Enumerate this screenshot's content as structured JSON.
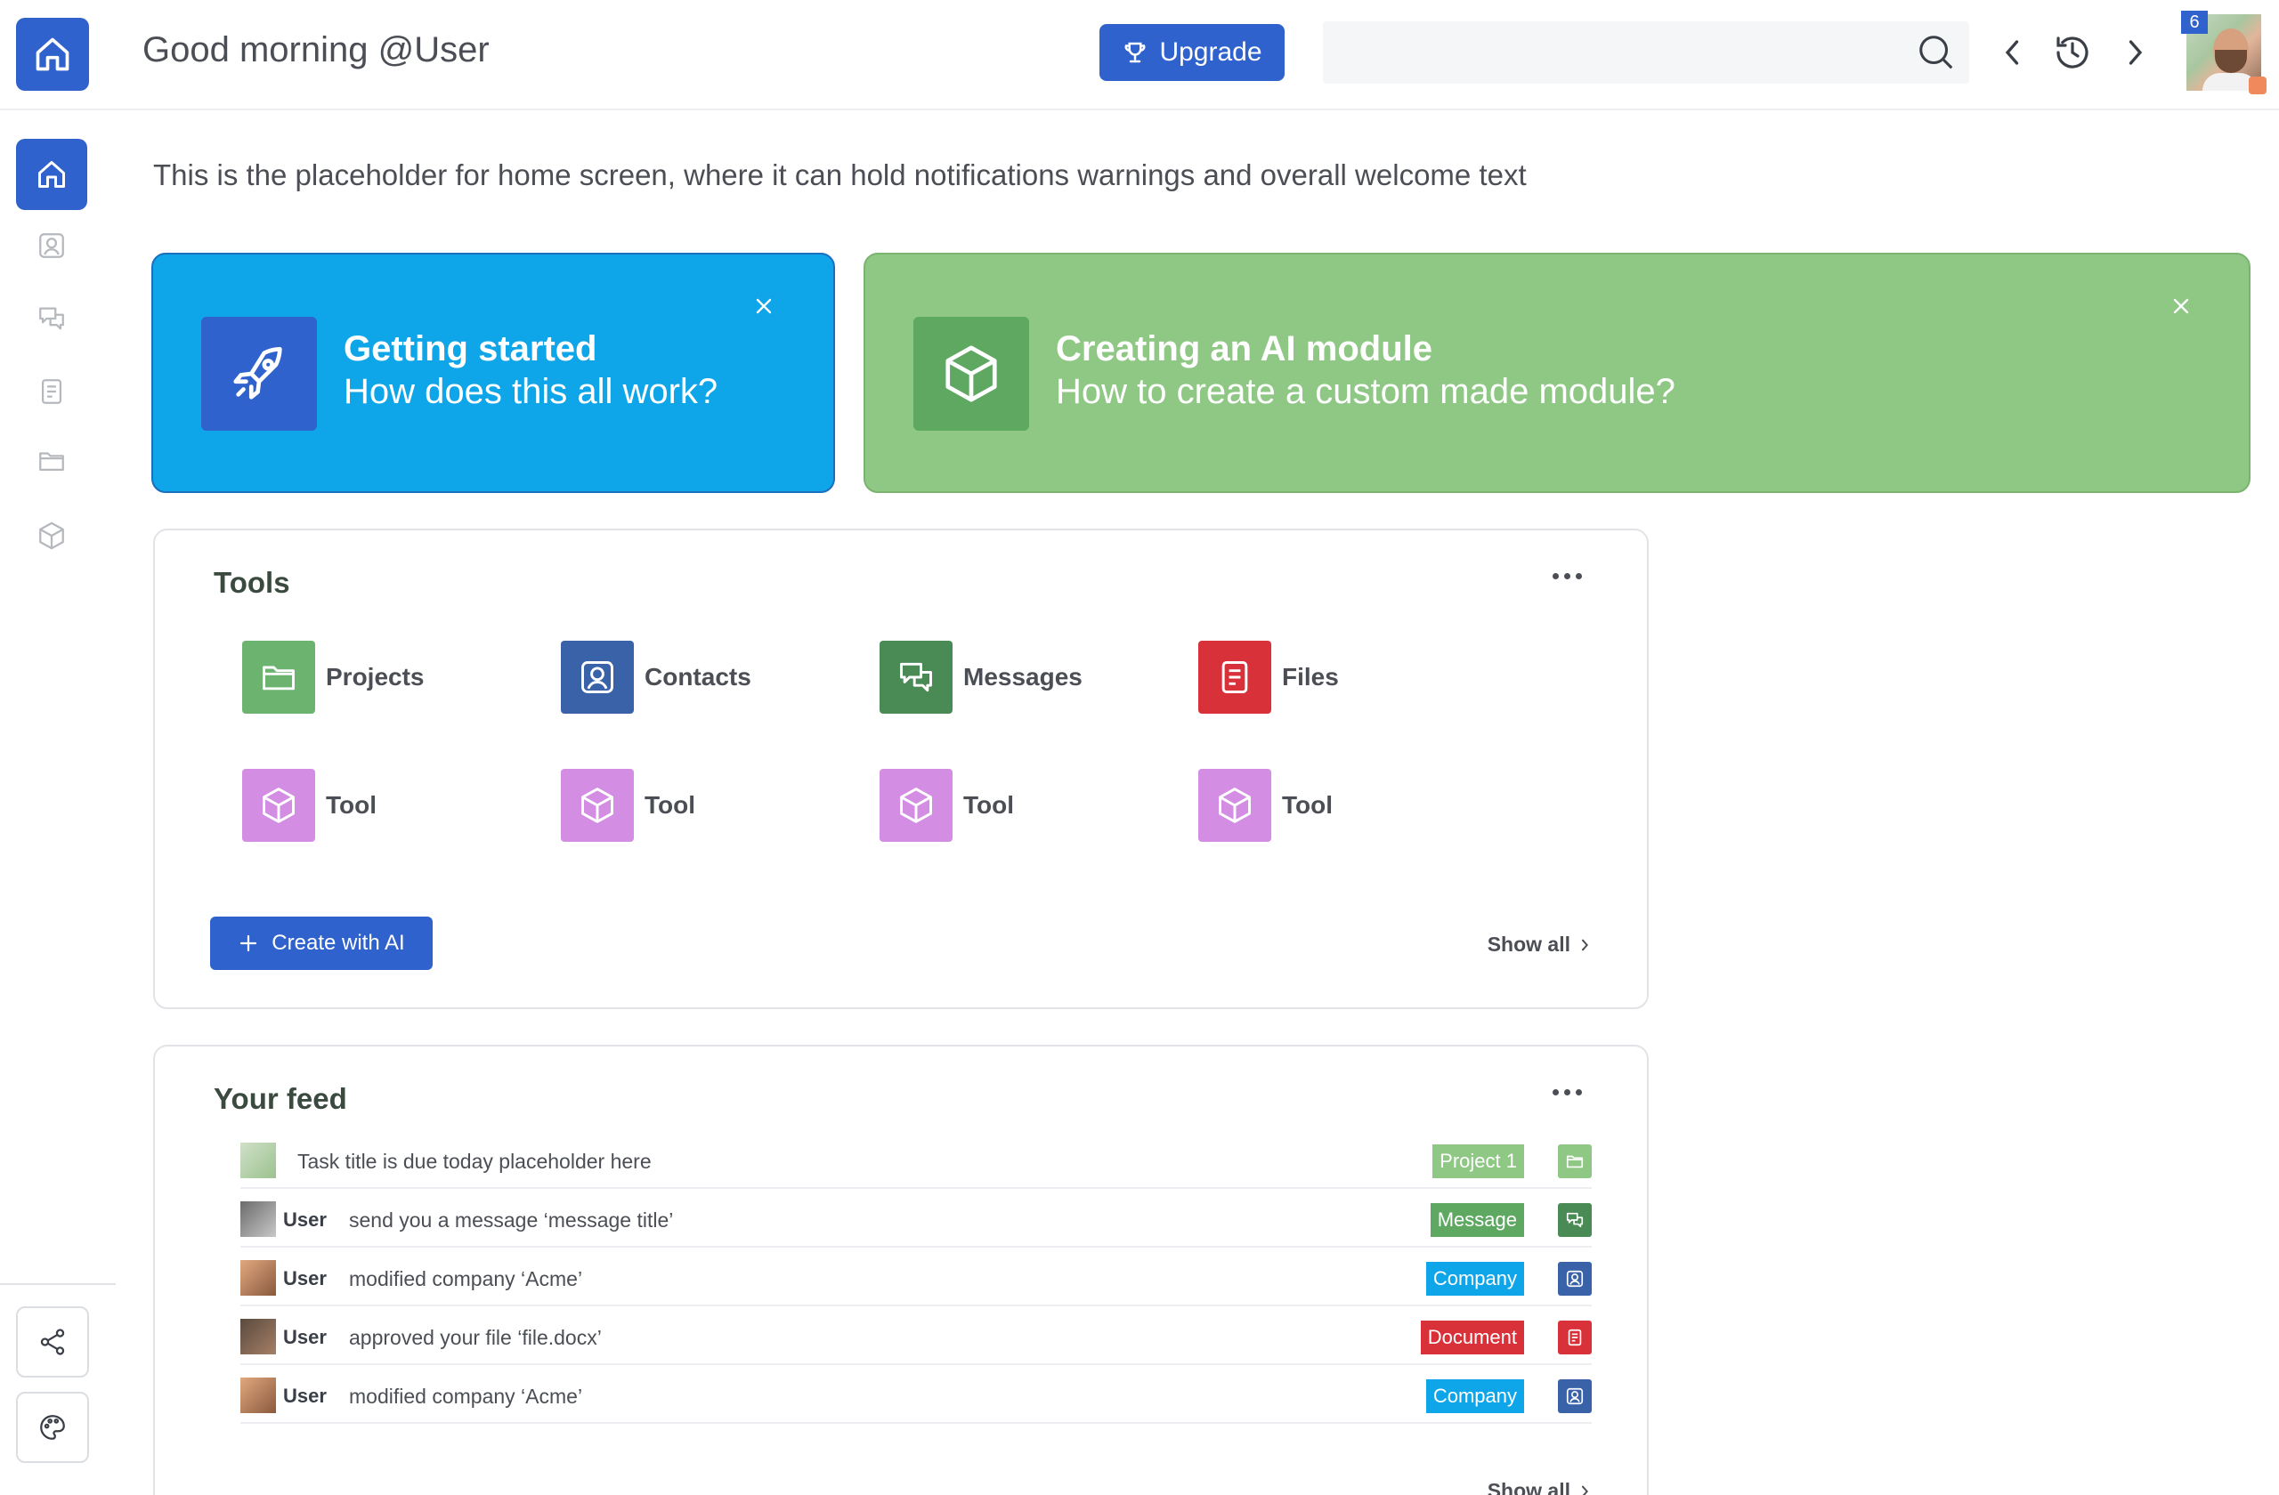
{
  "header": {
    "greeting": "Good morning @User",
    "upgrade_label": "Upgrade",
    "search_placeholder": "",
    "notification_count": "6"
  },
  "sidebar": {
    "items": [
      {
        "name": "home",
        "icon": "home-icon",
        "active": true
      },
      {
        "name": "contacts",
        "icon": "contact-icon"
      },
      {
        "name": "messages",
        "icon": "chat-icon"
      },
      {
        "name": "files",
        "icon": "document-icon"
      },
      {
        "name": "projects",
        "icon": "folder-icon"
      },
      {
        "name": "modules",
        "icon": "cube-icon"
      }
    ],
    "utilities": [
      "share-icon",
      "palette-icon"
    ]
  },
  "welcome_text": "This is the placeholder for home screen, where it can hold notifications warnings and overall welcome text",
  "cards": [
    {
      "title": "Getting started",
      "subtitle": "How does this all  work?",
      "icon": "rocket-icon",
      "color": "#0ea5e9"
    },
    {
      "title": "Creating an AI  module",
      "subtitle": "How to  create a custom made module?",
      "icon": "cube-icon",
      "color": "#8fc784"
    }
  ],
  "tools": {
    "title": "Tools",
    "items": [
      {
        "label": "Projects",
        "icon": "folder-icon",
        "color": "#6cb36f"
      },
      {
        "label": "Contacts",
        "icon": "contact-icon",
        "color": "#3a62a8"
      },
      {
        "label": "Messages",
        "icon": "chat-icon",
        "color": "#4a8a55"
      },
      {
        "label": "Files",
        "icon": "document-icon",
        "color": "#d9313a"
      },
      {
        "label": "Tool",
        "icon": "cube-icon",
        "color": "#d38ee3"
      },
      {
        "label": "Tool",
        "icon": "cube-icon",
        "color": "#d38ee3"
      },
      {
        "label": "Tool",
        "icon": "cube-icon",
        "color": "#d38ee3"
      },
      {
        "label": "Tool",
        "icon": "cube-icon",
        "color": "#d38ee3"
      }
    ],
    "create_label": "Create with AI",
    "show_all_label": "Show all"
  },
  "feed": {
    "title": "Your feed",
    "rows": [
      {
        "user": "",
        "text": "Task title is due today placeholder here",
        "tag": "Project 1",
        "tag_color": "#8fc784",
        "type_icon": "folder-icon"
      },
      {
        "user": "User",
        "text": "send you a message ‘message title’",
        "tag": "Message",
        "tag_color": "#5fa862",
        "type_icon": "chat-icon"
      },
      {
        "user": "User",
        "text": "modified company  ‘Acme’",
        "tag": "Company",
        "tag_color": "#0ea5e9",
        "type_icon": "contact-icon"
      },
      {
        "user": "User",
        "text": "approved your file ‘file.docx’",
        "tag": "Document",
        "tag_color": "#d9313a",
        "type_icon": "document-icon"
      },
      {
        "user": "User",
        "text": "modified company  ‘Acme’",
        "tag": "Company",
        "tag_color": "#0ea5e9",
        "type_icon": "contact-icon"
      }
    ],
    "show_all_label": "Show all"
  },
  "colors": {
    "primary": "#2f62cc",
    "accent_blue": "#0ea5e9",
    "accent_green": "#8fc784",
    "purple": "#d38ee3",
    "red": "#d9313a"
  }
}
